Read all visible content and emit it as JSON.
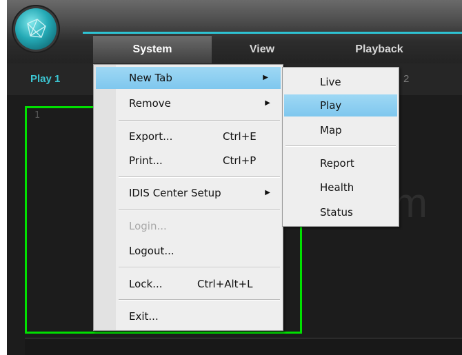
{
  "menubar": {
    "items": [
      "System",
      "View",
      "Playback"
    ]
  },
  "tabs": {
    "tab1": "Play 1",
    "tab2_partial": "2"
  },
  "content": {
    "pane1_number": "1",
    "pane2_background_text": "m"
  },
  "system_menu": {
    "new_tab": "New Tab",
    "remove": "Remove",
    "export": "Export...",
    "export_shortcut": "Ctrl+E",
    "print": "Print...",
    "print_shortcut": "Ctrl+P",
    "center_setup": "IDIS Center Setup",
    "login": "Login...",
    "logout": "Logout...",
    "lock": "Lock...",
    "lock_shortcut": "Ctrl+Alt+L",
    "exit": "Exit..."
  },
  "new_tab_submenu": {
    "live": "Live",
    "play": "Play",
    "map": "Map",
    "report": "Report",
    "health": "Health",
    "status": "Status"
  },
  "colors": {
    "accent": "#2ec3d3",
    "selection_frame": "#00e000",
    "menu_highlight": "#8fd0f1"
  }
}
